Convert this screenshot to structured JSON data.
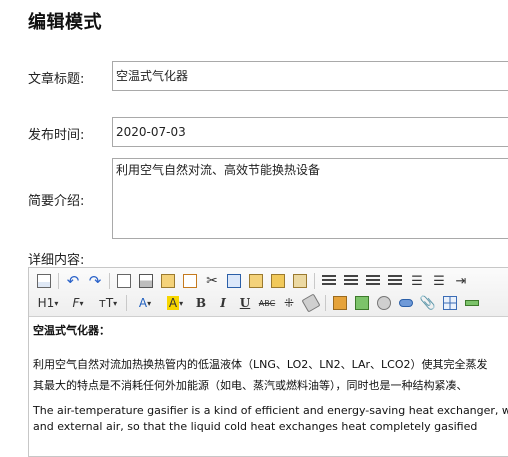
{
  "page": {
    "title": "编辑模式"
  },
  "form": {
    "title_label": "文章标题:",
    "title_value": "空温式气化器",
    "date_label": "发布时间:",
    "date_value": "2020-07-03",
    "summary_label": "简要介绍:",
    "summary_value": "利用空气自然对流、高效节能换热设备",
    "detail_label": "详细内容:"
  },
  "toolbar": {
    "heading_label": "H1",
    "font_family_label": "F",
    "font_size_label": "тT",
    "font_color_label": "A",
    "bg_color_label": "A",
    "bold_label": "B",
    "italic_label": "I",
    "underline_label": "U",
    "strike_label": "ABC",
    "colors": {
      "font_color": "#1f5fbf",
      "highlight": "#f7d600"
    }
  },
  "editor": {
    "heading": "空温式气化器：",
    "line1": "利用空气自然对流加热换热管内的低温液体（LNG、LO2、LN2、LAr、LCO2）使其完全蒸发",
    "line2": "其最大的特点是不消耗任何外加能源（如电、蒸汽或燃料油等），同时也是一种结构紧凑、",
    "line3": "The air-temperature gasifier is a kind of efficient and energy-saving heat exchanger, whic",
    "line4": "and  external  air,  so  that  the  liquid  cold  heat  exchanges  heat  completely  gasified"
  }
}
